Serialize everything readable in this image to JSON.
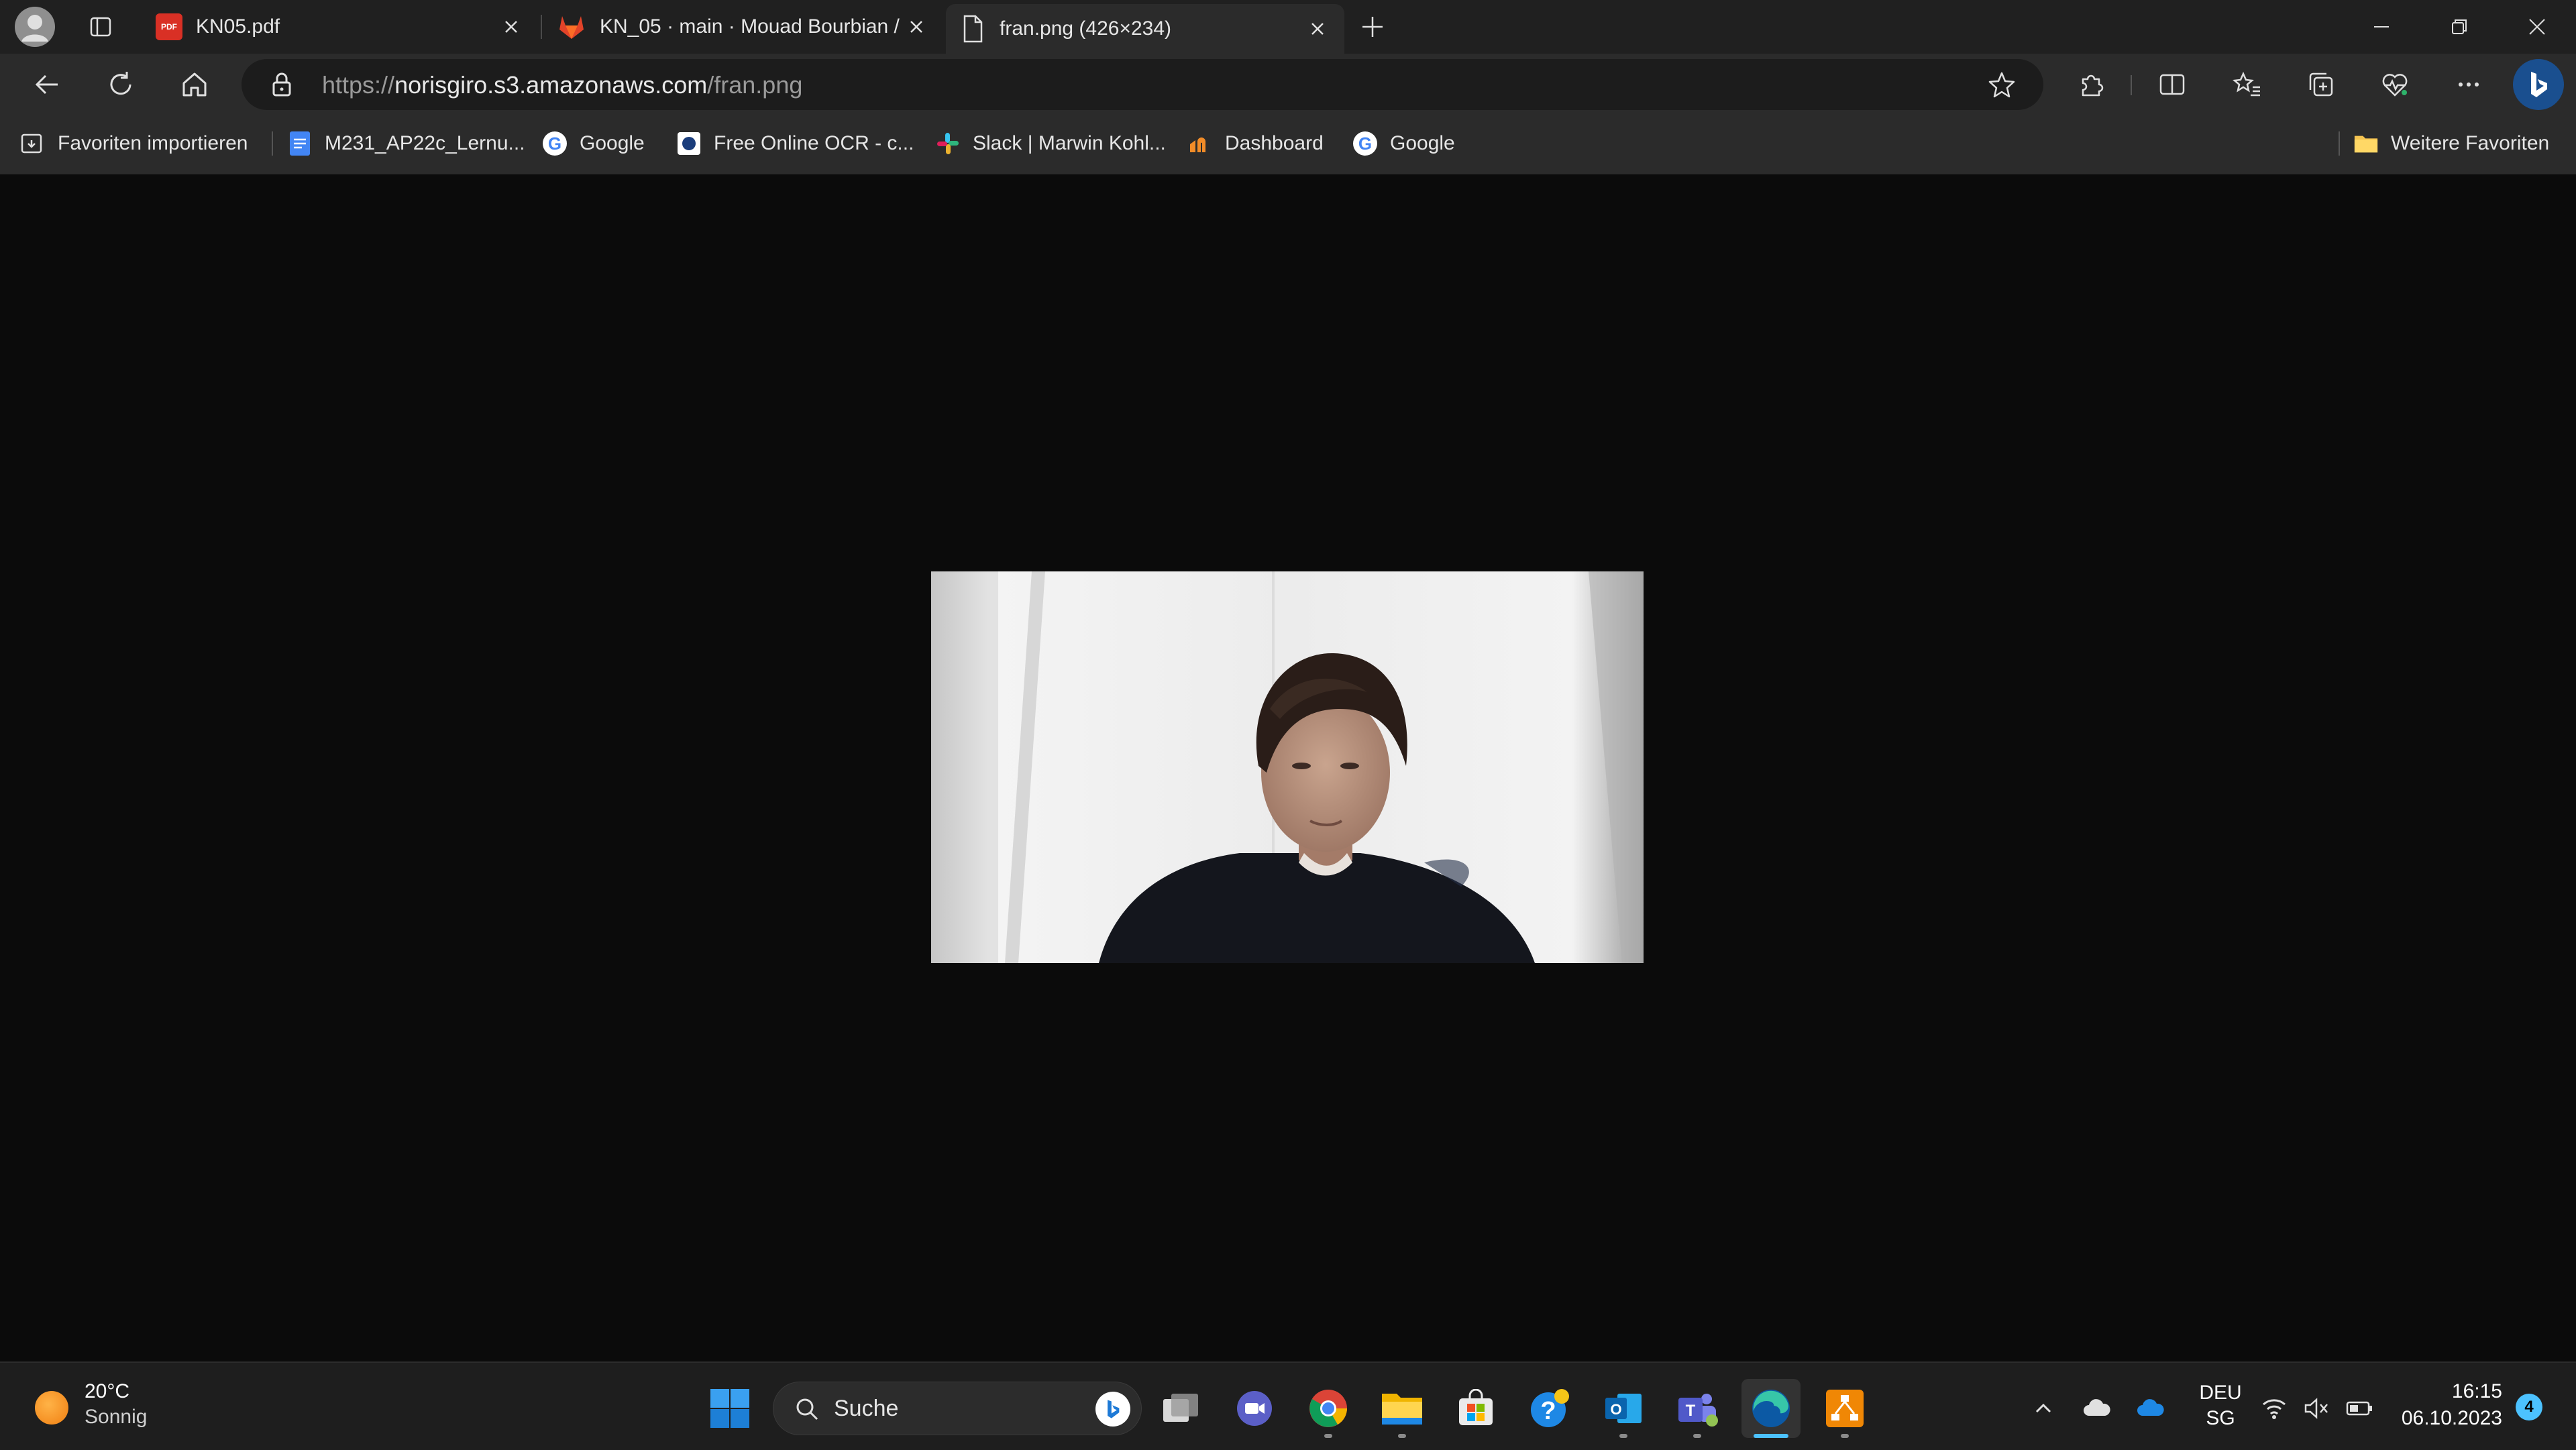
{
  "browser": {
    "tabs": [
      {
        "label": "KN05.pdf",
        "icon": "pdf-icon",
        "active": false
      },
      {
        "label": "KN_05 · main · Mouad Bourbian /",
        "icon": "gitlab-icon",
        "active": false
      },
      {
        "label": "fran.png (426×234)",
        "icon": "file-icon",
        "active": true
      }
    ],
    "address": {
      "scheme": "https://",
      "host": "norisgiro.s3.amazonaws.com",
      "path": "/fran.png"
    },
    "favorites": [
      {
        "label": "Favoriten importieren",
        "icon": "import-icon"
      },
      {
        "label": "M231_AP22c_Lernu...",
        "icon": "docs-icon"
      },
      {
        "label": "Google",
        "icon": "google-icon"
      },
      {
        "label": "Free Online OCR - c...",
        "icon": "ocr-icon"
      },
      {
        "label": "Slack | Marwin Kohl...",
        "icon": "slack-icon"
      },
      {
        "label": "Dashboard",
        "icon": "dashboard-icon"
      },
      {
        "label": "Google",
        "icon": "google-icon"
      }
    ],
    "other_favorites": "Weitere Favoriten"
  },
  "taskbar": {
    "weather": {
      "temp": "20°C",
      "condition": "Sonnig"
    },
    "search_placeholder": "Suche",
    "language": {
      "lang": "DEU",
      "layout": "SG"
    },
    "clock": {
      "time": "16:15",
      "date": "06.10.2023"
    },
    "notifications": "4"
  },
  "colors": {
    "accent": "#0078d4",
    "edge_blue": "#1e7ad6",
    "page_bg": "#0b0b0b"
  }
}
